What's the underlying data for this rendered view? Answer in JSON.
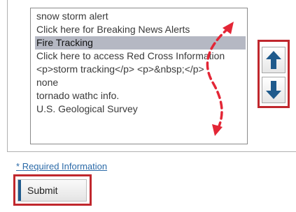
{
  "listbox": {
    "items": [
      {
        "label": "snow storm alert",
        "selected": false
      },
      {
        "label": "Click here for Breaking News Alerts",
        "selected": false
      },
      {
        "label": "Fire Tracking",
        "selected": true
      },
      {
        "label": "Click here to access Red Cross Information",
        "selected": false
      },
      {
        "label": "<p>storm tracking</p> <p>&nbsp;</p>",
        "selected": false
      },
      {
        "label": "none",
        "selected": false
      },
      {
        "label": "tornado wathc info.",
        "selected": false
      },
      {
        "label": "U.S. Geological Survey",
        "selected": false
      }
    ]
  },
  "order_buttons": {
    "up_icon": "arrow-up-icon",
    "down_icon": "arrow-down-icon",
    "arrow_color": "#1f5a8c"
  },
  "form": {
    "asterisk": "*",
    "required_text": "Required Information",
    "submit_label": "Submit"
  },
  "highlight_color": "#c0272d",
  "annotation": {
    "icon": "drag-reorder-arrow-icon",
    "color": "#e32636"
  }
}
